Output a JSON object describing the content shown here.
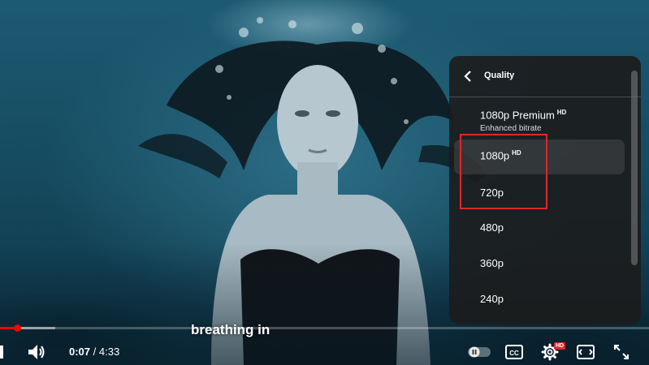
{
  "quality_menu": {
    "title": "Quality",
    "items": [
      {
        "label": "1080p Premium",
        "badge": "HD",
        "sublabel": "Enhanced bitrate"
      },
      {
        "label": "1080p",
        "badge": "HD",
        "selected": true
      },
      {
        "label": "720p"
      },
      {
        "label": "480p"
      },
      {
        "label": "360p"
      },
      {
        "label": "240p"
      }
    ]
  },
  "caption": "breathing in",
  "player": {
    "current_time": "0:07",
    "separator": " / ",
    "duration": "4:33",
    "progress_fraction": 0.026,
    "buffered_fraction": 0.085,
    "settings_badge": "HD",
    "icons": [
      "volume-icon",
      "autoplay-toggle",
      "captions-icon",
      "settings-icon",
      "miniplayer-icon",
      "fullscreen-icon"
    ]
  },
  "colors": {
    "accent": "#ff0000",
    "highlight_box": "#e0262b",
    "menu_bg": "#1c1c1c"
  }
}
